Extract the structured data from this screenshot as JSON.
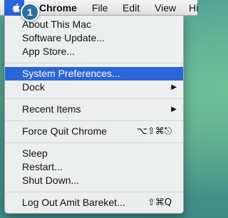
{
  "menubar": {
    "apple_icon": "apple-logo-icon",
    "menus": [
      "Chrome",
      "File",
      "Edit",
      "View",
      "Hi"
    ]
  },
  "callout": {
    "number": "1"
  },
  "apple_menu": {
    "items": [
      {
        "label": "About This Mac"
      },
      {
        "label": "Software Update..."
      },
      {
        "label": "App Store..."
      },
      {
        "label": "System Preferences...",
        "highlighted": true
      },
      {
        "label": "Dock",
        "submenu": true,
        "arrow": "▶"
      },
      {
        "label": "Recent Items",
        "submenu": true,
        "arrow": "▶"
      },
      {
        "label": "Force Quit Chrome",
        "shortcut": "⌥⇧⌘⎋"
      },
      {
        "label": "Sleep"
      },
      {
        "label": "Restart..."
      },
      {
        "label": "Shut Down..."
      },
      {
        "label": "Log Out Amit Bareket...",
        "shortcut": "⇧⌘Q"
      }
    ]
  },
  "colors": {
    "highlight": "#2a65d9",
    "badge": "#2f6ea3"
  }
}
